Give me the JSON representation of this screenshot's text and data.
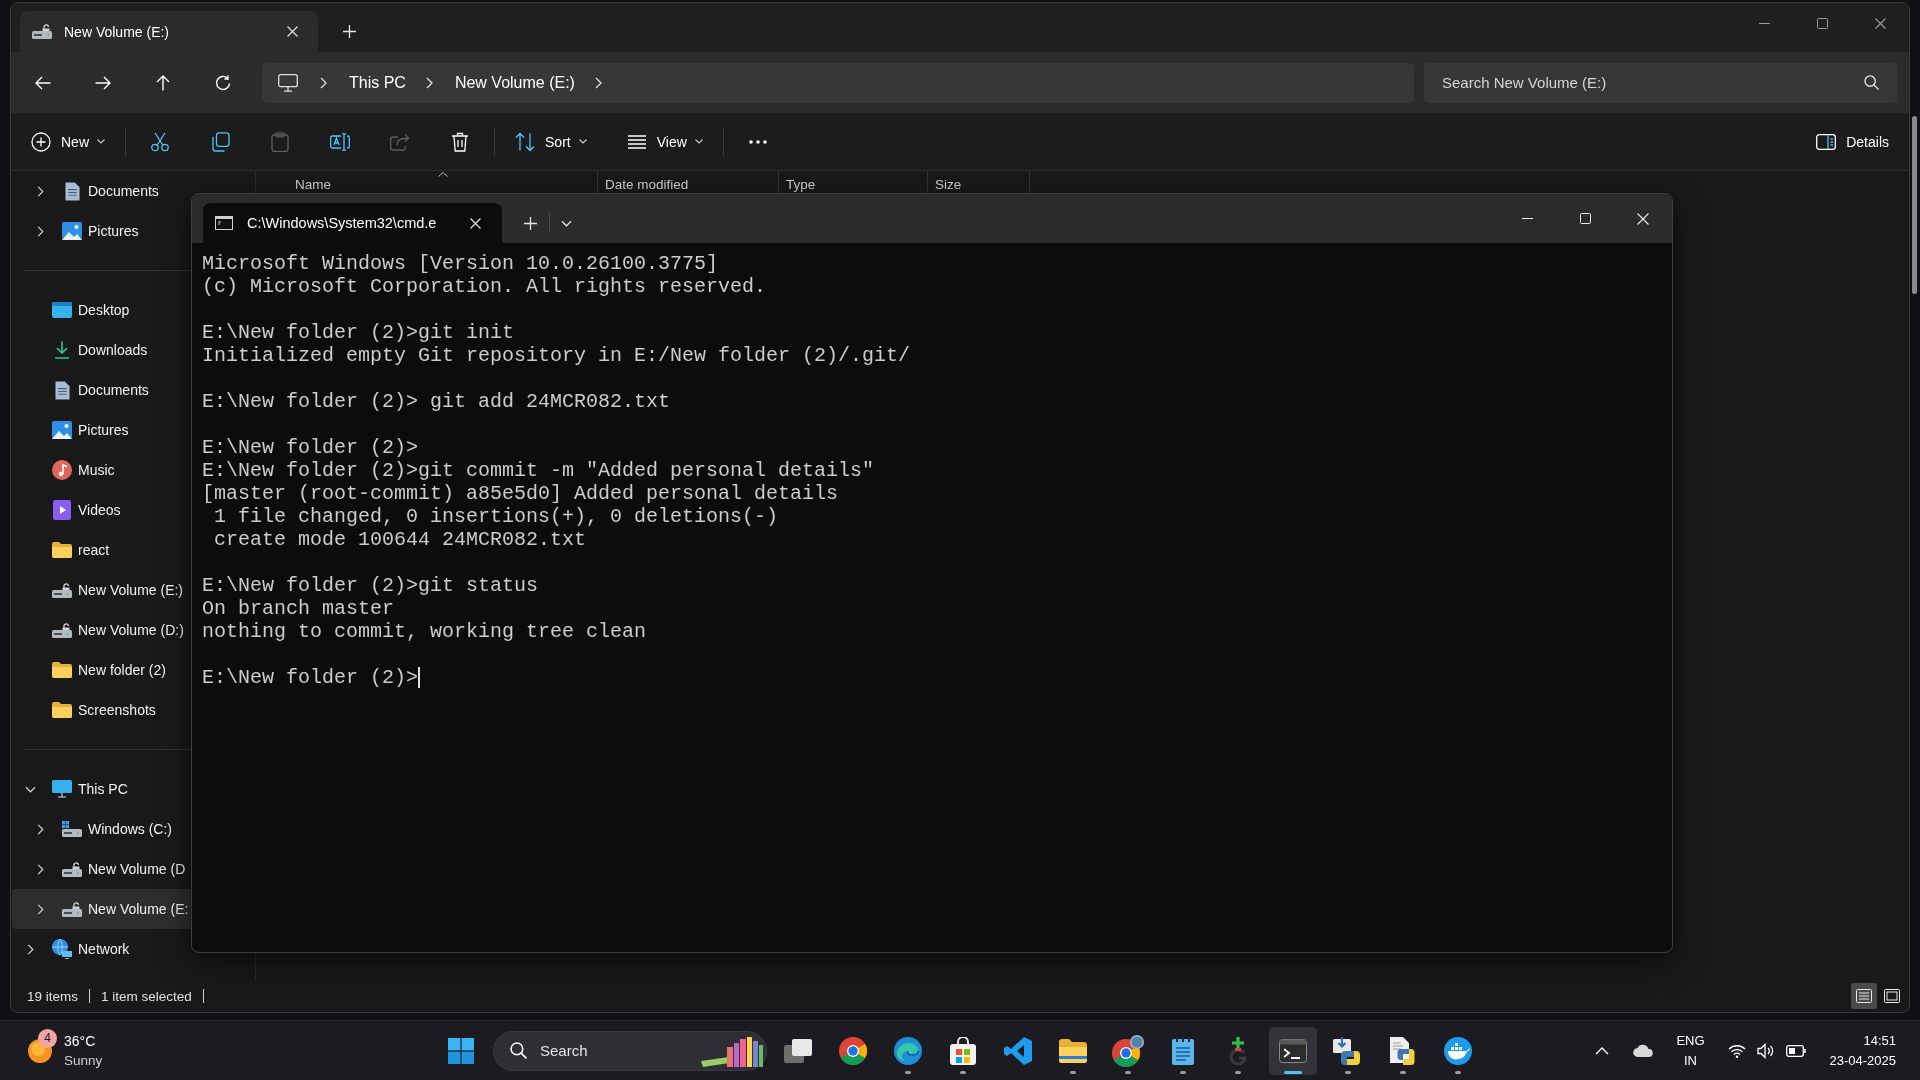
{
  "explorer": {
    "tabs": [
      {
        "title": "New Volume (E:)",
        "selected": true
      }
    ],
    "breadcrumb": [
      "This PC",
      "New Volume (E:)"
    ],
    "search": {
      "placeholder": "Search New Volume (E:)"
    },
    "command_groups": [
      [
        {
          "kind": "new",
          "label": "New",
          "disabled": false
        }
      ],
      [
        {
          "kind": "cut",
          "disabled": false
        },
        {
          "kind": "copy",
          "disabled": false
        },
        {
          "kind": "paste",
          "disabled": true
        },
        {
          "kind": "rename",
          "disabled": false
        },
        {
          "kind": "share",
          "disabled": true
        },
        {
          "kind": "delete",
          "disabled": false
        }
      ],
      [
        {
          "kind": "sort",
          "label": "Sort",
          "disabled": false
        },
        {
          "kind": "view",
          "label": "View",
          "disabled": false
        }
      ],
      [
        {
          "kind": "more",
          "disabled": false
        }
      ]
    ],
    "details_button": {
      "label": "Details"
    },
    "sidebar": {
      "sections": [
        {
          "kind": "nested",
          "items": [
            {
              "label": "Documents",
              "kind": "documents",
              "expanded": false,
              "selected": false
            },
            {
              "label": "Pictures",
              "kind": "pictures",
              "expanded": false,
              "selected": false
            }
          ]
        },
        {
          "kind": "pinned",
          "items": [
            {
              "label": "Desktop",
              "kind": "desktop",
              "selected": false
            },
            {
              "label": "Downloads",
              "kind": "downloads",
              "selected": false
            },
            {
              "label": "Documents",
              "kind": "documents",
              "selected": false
            },
            {
              "label": "Pictures",
              "kind": "pictures",
              "selected": false
            },
            {
              "label": "Music",
              "kind": "music",
              "selected": false
            },
            {
              "label": "Videos",
              "kind": "videos",
              "selected": false
            },
            {
              "label": "react",
              "kind": "folder",
              "selected": false
            },
            {
              "label": "New Volume (E:)",
              "kind": "drive",
              "selected": false
            },
            {
              "label": "New Volume (D:)",
              "kind": "drive",
              "selected": false
            },
            {
              "label": "New folder (2)",
              "kind": "folder",
              "selected": false
            },
            {
              "label": "Screenshots",
              "kind": "folder",
              "selected": false
            }
          ]
        },
        {
          "kind": "tree",
          "items": [
            {
              "label": "This PC",
              "kind": "pc",
              "expanded": true,
              "selected": false,
              "children": [
                {
                  "label": "Windows (C:)",
                  "kind": "system-drive",
                  "expanded": false,
                  "selected": false
                },
                {
                  "label": "New Volume (D",
                  "kind": "drive",
                  "expanded": false,
                  "selected": false
                },
                {
                  "label": "New Volume (E:",
                  "kind": "drive",
                  "expanded": false,
                  "selected": true
                }
              ]
            },
            {
              "label": "Network",
              "kind": "network",
              "expanded": false,
              "selected": false
            }
          ]
        }
      ]
    },
    "columns": [
      {
        "label": "Name",
        "sorted": true
      },
      {
        "label": "Date modified",
        "sorted": false
      },
      {
        "label": "Type",
        "sorted": false
      },
      {
        "label": "Size",
        "sorted": false
      }
    ],
    "status": {
      "item_count": "19 items",
      "selection": "1 item selected"
    },
    "view_modes": [
      {
        "kind": "details",
        "selected": true
      },
      {
        "kind": "tiles",
        "selected": false
      }
    ]
  },
  "terminal": {
    "tabs": [
      {
        "title": "C:\\Windows\\System32\\cmd.e",
        "selected": true
      }
    ],
    "blocks": [
      [
        "Microsoft Windows [Version 10.0.26100.3775]",
        "(c) Microsoft Corporation. All rights reserved."
      ],
      [
        "E:\\New folder (2)>git init",
        "Initialized empty Git repository in E:/New folder (2)/.git/"
      ],
      [
        "E:\\New folder (2)> git add 24MCR082.txt"
      ],
      [
        "E:\\New folder (2)>",
        "E:\\New folder (2)>git commit -m \"Added personal details\"",
        "[master (root-commit) a85e5d0] Added personal details",
        " 1 file changed, 0 insertions(+), 0 deletions(-)",
        " create mode 100644 24MCR082.txt"
      ],
      [
        "E:\\New folder (2)>git status",
        "On branch master",
        "nothing to commit, working tree clean"
      ],
      [
        "E:\\New folder (2)>"
      ]
    ],
    "cursor": true
  },
  "taskbar": {
    "weather": {
      "badge": "4",
      "temperature": "36°C",
      "condition": "Sunny"
    },
    "search": {
      "placeholder": "Search"
    },
    "apps": [
      {
        "kind": "taskview",
        "running": false,
        "selected": false
      },
      {
        "kind": "chrome",
        "running": false,
        "selected": false
      },
      {
        "kind": "edge",
        "running": true,
        "selected": false
      },
      {
        "kind": "store",
        "running": true,
        "selected": false
      },
      {
        "kind": "code",
        "running": false,
        "selected": false
      },
      {
        "kind": "files",
        "running": true,
        "selected": false
      },
      {
        "kind": "profile",
        "running": true,
        "selected": false
      },
      {
        "kind": "notepad",
        "running": true,
        "selected": false
      },
      {
        "kind": "git",
        "running": true,
        "selected": false
      },
      {
        "kind": "terminal",
        "running": true,
        "selected": true
      },
      {
        "kind": "installer",
        "running": true,
        "selected": false
      },
      {
        "kind": "script",
        "running": true,
        "selected": false
      },
      {
        "kind": "docker",
        "running": true,
        "selected": false
      }
    ],
    "tray": {
      "language": "ENG",
      "region": "IN",
      "time": "14:51",
      "date": "23-04-2025"
    }
  }
}
